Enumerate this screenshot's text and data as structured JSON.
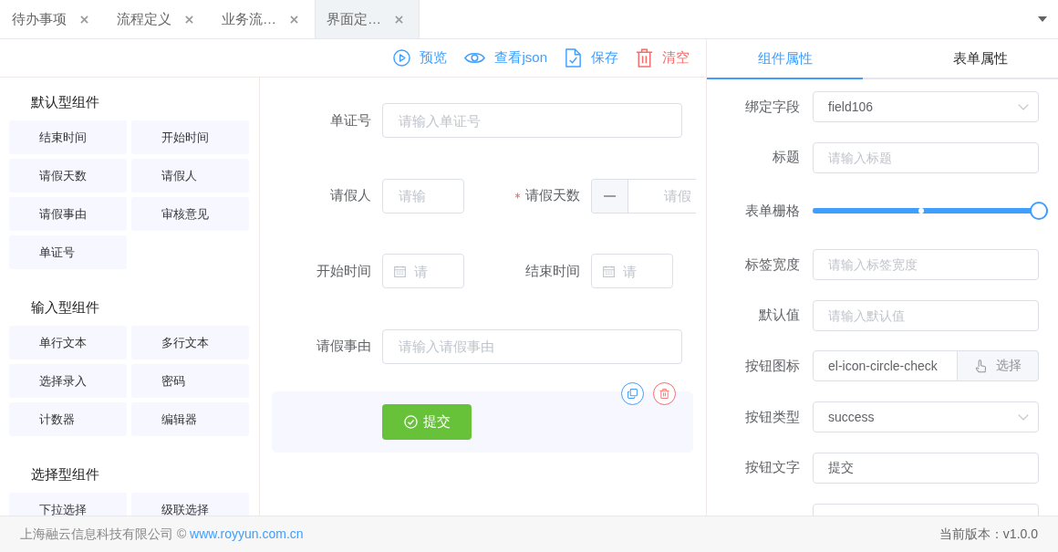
{
  "tabs": [
    {
      "label": "待办事项",
      "selected": false
    },
    {
      "label": "流程定义",
      "selected": false
    },
    {
      "label": "业务流…",
      "selected": false
    },
    {
      "label": "界面定…",
      "selected": true
    }
  ],
  "toolbar": [
    {
      "kind": "preview",
      "label": "预览"
    },
    {
      "kind": "json",
      "label": "查看json"
    },
    {
      "kind": "save",
      "label": "保存"
    },
    {
      "kind": "clear",
      "label": "清空"
    }
  ],
  "component_groups": [
    {
      "title": "默认型组件",
      "items": [
        "结束时间",
        "开始时间",
        "请假天数",
        "请假人",
        "请假事由",
        "审核意见",
        "单证号"
      ]
    },
    {
      "title": "输入型组件",
      "items": [
        "单行文本",
        "多行文本",
        "选择录入",
        "密码",
        "计数器",
        "编辑器"
      ]
    },
    {
      "title": "选择型组件",
      "items": [
        "下拉选择",
        "级联选择"
      ]
    }
  ],
  "form": {
    "rows": [
      {
        "selected": false,
        "fields": [
          {
            "kind": "input",
            "label": "单证号",
            "required": false,
            "placeholder": "请输入单证号"
          }
        ]
      },
      {
        "selected": false,
        "fields": [
          {
            "kind": "input",
            "label": "请假人",
            "required": false,
            "placeholder": "请输"
          },
          {
            "kind": "number",
            "label": "请假天数",
            "required": true,
            "placeholder": "请假"
          }
        ]
      },
      {
        "selected": false,
        "fields": [
          {
            "kind": "date",
            "label": "开始时间",
            "required": false,
            "placeholder": "请"
          },
          {
            "kind": "date",
            "label": "结束时间",
            "required": false,
            "placeholder": "请"
          }
        ]
      },
      {
        "selected": false,
        "fields": [
          {
            "kind": "input",
            "label": "请假事由",
            "required": false,
            "placeholder": "请输入请假事由"
          }
        ]
      },
      {
        "selected": true,
        "fields": [
          {
            "kind": "button",
            "label": "提交",
            "required": false
          }
        ]
      }
    ]
  },
  "properties": {
    "tabs": [
      {
        "label": "组件属性",
        "selected": true
      },
      {
        "label": "表单属性",
        "selected": false
      }
    ],
    "fields": [
      {
        "kind": "select",
        "label": "绑定字段",
        "value": "field106"
      },
      {
        "kind": "input",
        "label": "标题",
        "placeholder": "请输入标题"
      },
      {
        "kind": "slider",
        "label": "表单栅格",
        "level": 1
      },
      {
        "kind": "input",
        "label": "标签宽度",
        "placeholder": "请输入标签宽度"
      },
      {
        "kind": "input",
        "label": "默认值",
        "placeholder": "请输入默认值"
      },
      {
        "kind": "icon-picker",
        "label": "按钮图标",
        "value": "el-icon-circle-check",
        "button": "选择"
      },
      {
        "kind": "select",
        "label": "按钮类型",
        "value": "success"
      },
      {
        "kind": "input",
        "label": "按钮文字",
        "value": "提交"
      },
      {
        "kind": "input"
      }
    ]
  },
  "footer": {
    "copyright": "上海融云信息科技有限公司 ©",
    "link": "www.royyun.com.cn",
    "version": "当前版本：v1.0.0"
  }
}
